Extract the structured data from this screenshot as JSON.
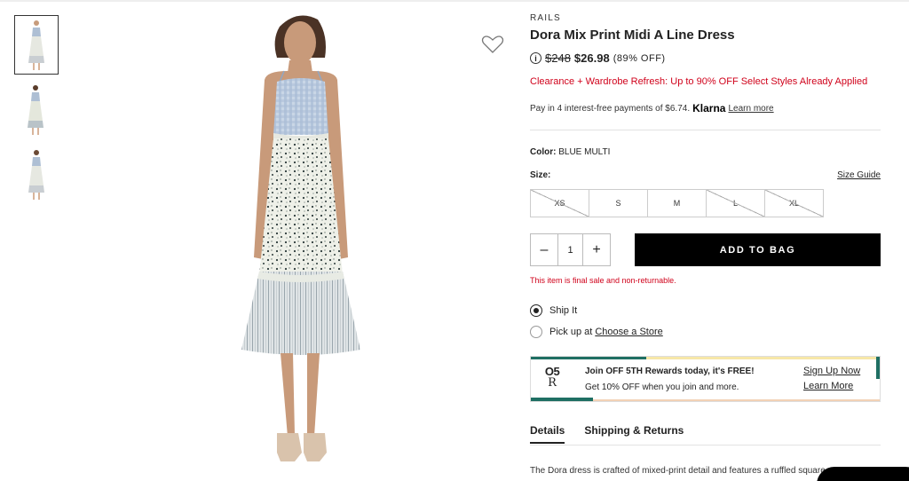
{
  "gallery": {
    "thumbnail_count": 3,
    "active_index": 0
  },
  "product": {
    "brand": "RAILS",
    "title": "Dora Mix Print Midi A Line Dress",
    "info_icon": "i",
    "original_price": "$248",
    "sale_price": "$26.98",
    "discount": "(89% OFF)",
    "promo": "Clearance + Wardrobe Refresh: Up to 90% OFF Select Styles Already Applied",
    "klarna": {
      "text": "Pay in 4 interest-free payments of $6.74.",
      "brand": "Klarna",
      "link": "Learn more"
    },
    "color": {
      "label": "Color:",
      "value": "BLUE MULTI"
    },
    "size": {
      "label": "Size:",
      "guide": "Size Guide",
      "options": [
        {
          "label": "XS",
          "available": false
        },
        {
          "label": "S",
          "available": true
        },
        {
          "label": "M",
          "available": true
        },
        {
          "label": "L",
          "available": false
        },
        {
          "label": "XL",
          "available": false
        }
      ]
    },
    "quantity": {
      "minus": "–",
      "value": "1",
      "plus": "+"
    },
    "add_to_bag": "ADD TO BAG",
    "final_sale": "This item is final sale and non-returnable."
  },
  "fulfillment": {
    "ship_it": "Ship It",
    "pickup_prefix": "Pick up at",
    "pickup_link": "Choose a Store",
    "selected": "ship_it"
  },
  "rewards": {
    "logo_top": "O5",
    "logo_bottom": "R",
    "headline": "Join OFF 5TH Rewards today, it's FREE!",
    "sub": "Get 10% OFF when you join and more.",
    "signup": "Sign Up Now",
    "learn": "Learn More",
    "colors": {
      "teal": "#1f6f63",
      "peach": "#f2d1b5",
      "yellow": "#f7e7a8"
    }
  },
  "tabs": [
    {
      "label": "Details",
      "active": true
    },
    {
      "label": "Shipping & Returns",
      "active": false
    }
  ],
  "description": "The Dora dress is crafted of mixed-print detail and features a ruffled square",
  "colors": {
    "accent_red": "#d0021b",
    "button_black": "#000000"
  }
}
